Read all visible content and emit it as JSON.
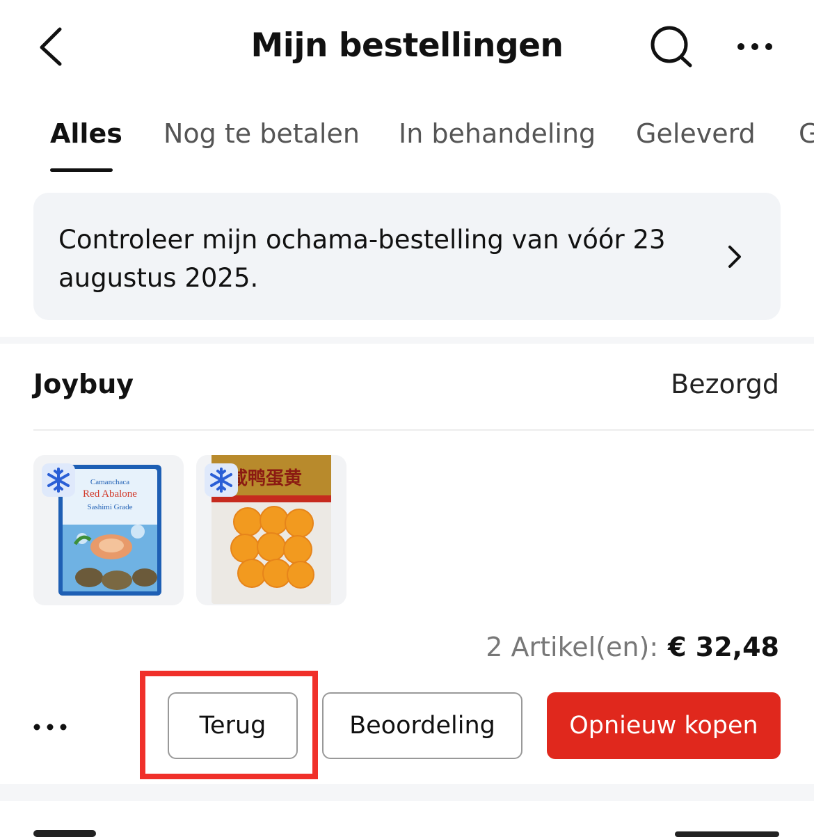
{
  "header": {
    "title": "Mijn bestellingen"
  },
  "tabs": [
    {
      "label": "Alles",
      "active": true
    },
    {
      "label": "Nog te betalen",
      "active": false
    },
    {
      "label": "In behandeling",
      "active": false
    },
    {
      "label": "Geleverd",
      "active": false
    },
    {
      "label": "G",
      "active": false
    }
  ],
  "banner": {
    "text": "Controleer mijn ochama-bestelling van vóór 23 augustus 2025."
  },
  "order": {
    "shop": "Joybuy",
    "status": "Bezorgd",
    "items": [
      {
        "icon": "frozen-snowflake-icon",
        "package_text": [
          "Camanchaca",
          "Red Abalone",
          "Sashimi Grade"
        ]
      },
      {
        "icon": "frozen-snowflake-icon",
        "package_text": [
          "咸鸭蛋黄"
        ]
      }
    ],
    "summary_count": "2 Artikel(en):",
    "summary_total": "€ 32,48",
    "actions": {
      "return_label": "Terug",
      "review_label": "Beoordeling",
      "buy_again_label": "Opnieuw kopen"
    }
  },
  "colors": {
    "accent_red": "#e0281d",
    "highlight_red": "#f0302a",
    "banner_bg": "#f2f4f7"
  }
}
